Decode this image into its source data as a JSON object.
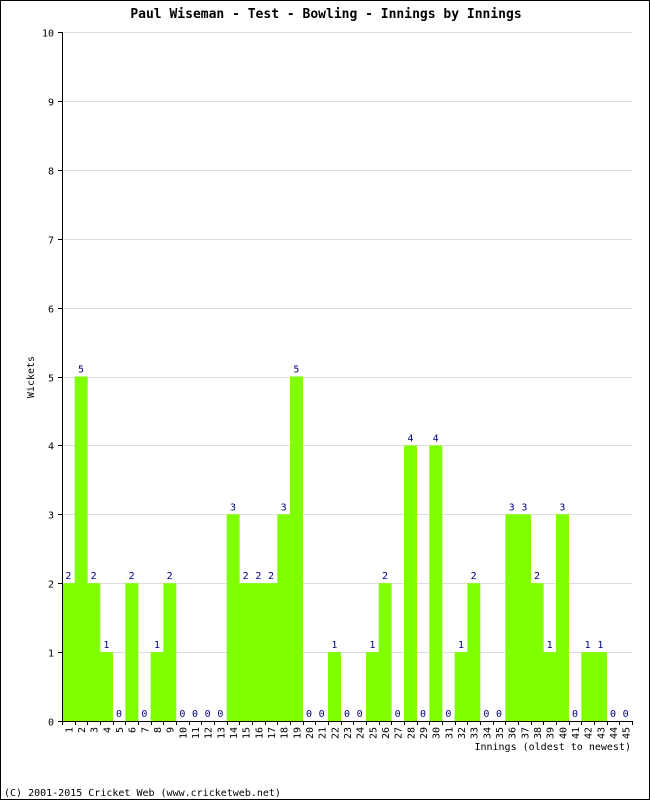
{
  "chart_data": {
    "type": "bar",
    "title": "Paul Wiseman - Test - Bowling - Innings by Innings",
    "xlabel": "Innings (oldest to newest)",
    "ylabel": "Wickets",
    "ylim": [
      0,
      10
    ],
    "yticks": [
      0,
      1,
      2,
      3,
      4,
      5,
      6,
      7,
      8,
      9,
      10
    ],
    "grid": true,
    "categories": [
      "1",
      "2",
      "3",
      "4",
      "5",
      "6",
      "7",
      "8",
      "9",
      "10",
      "11",
      "12",
      "13",
      "14",
      "15",
      "16",
      "17",
      "18",
      "19",
      "20",
      "21",
      "22",
      "23",
      "24",
      "25",
      "26",
      "27",
      "28",
      "29",
      "30",
      "31",
      "32",
      "33",
      "34",
      "35",
      "36",
      "37",
      "38",
      "39",
      "40",
      "41",
      "42",
      "43",
      "44",
      "45"
    ],
    "values": [
      2,
      5,
      2,
      1,
      0,
      2,
      0,
      1,
      2,
      0,
      0,
      0,
      0,
      3,
      2,
      2,
      2,
      3,
      5,
      0,
      0,
      1,
      0,
      0,
      1,
      2,
      0,
      4,
      0,
      4,
      0,
      1,
      2,
      0,
      0,
      3,
      3,
      2,
      1,
      3,
      0,
      1,
      1,
      0,
      0
    ],
    "bar_color": "#80ff00",
    "label_color": "#000080",
    "grid_color": "#dddddd"
  },
  "footer": "(C) 2001-2015 Cricket Web (www.cricketweb.net)"
}
